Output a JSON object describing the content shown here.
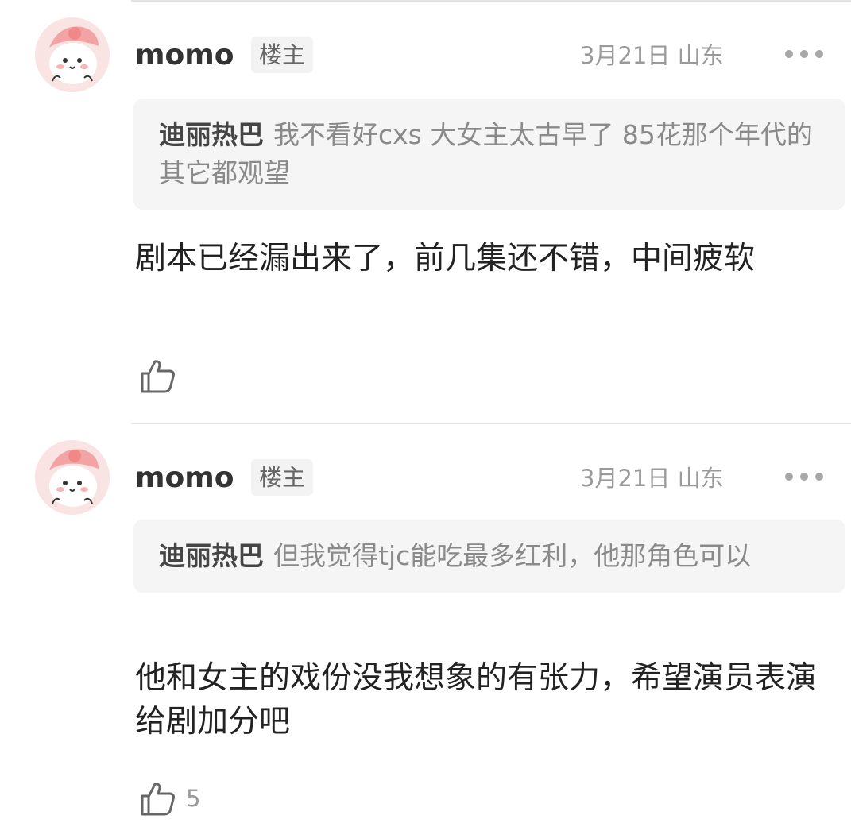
{
  "comments": [
    {
      "username": "momo",
      "badge": "楼主",
      "meta": "3月21日 山东",
      "quote": {
        "author": "迪丽热巴",
        "text": "我不看好cxs 大女主太古早了 85花那个年代的 其它都观望"
      },
      "text": "剧本已经漏出来了，前几集还不错，中间疲软",
      "like_count": ""
    },
    {
      "username": "momo",
      "badge": "楼主",
      "meta": "3月21日 山东",
      "quote": {
        "author": "迪丽热巴",
        "text": "但我觉得tjc能吃最多红利，他那角色可以"
      },
      "text": "他和女主的戏份没我想象的有张力，希望演员表演给剧加分吧",
      "like_count": "5"
    }
  ],
  "icons": {
    "avatar": "cartoon-avatar-icon",
    "more": "more-dots-icon",
    "like": "thumbs-up-icon"
  },
  "colors": {
    "avatar_bg": "#f7e4e4",
    "avatar_accent": "#f08080",
    "quote_bg": "#f5f5f5",
    "muted_text": "#9a9a9a"
  }
}
